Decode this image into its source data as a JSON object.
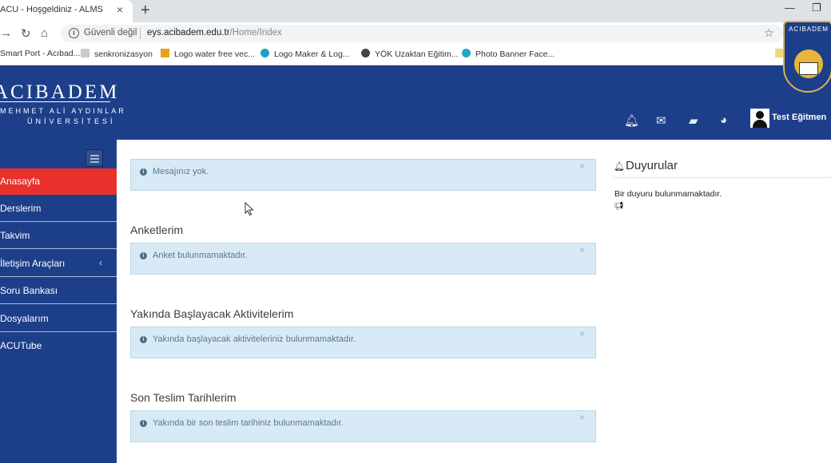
{
  "browser": {
    "tab_title": "ACU - Hoşgeldiniz - ALMS",
    "tab_close": "×",
    "new_tab": "+",
    "security_label": "Güvenli değil",
    "url_host": "eys.acibadem.edu.tr",
    "url_path": "/Home/Index",
    "bookmarks": [
      "Smart Port - Acıbad...",
      "senkronizasyon",
      "Logo water free vec...",
      "Logo Maker & Log...",
      "YÖK Uzaktan Eğitim...",
      "Photo Banner Face..."
    ]
  },
  "header": {
    "logo_main": "ACIBADEM",
    "logo_sub1": "MEHMET ALİ AYDINLAR",
    "logo_sub2": "ÜNİVERSİTESİ",
    "user_name": "Test Eğitmen",
    "emblem_text": "ACIBADEM"
  },
  "sidebar": {
    "items": [
      {
        "label": "Anasayfa",
        "active": true
      },
      {
        "label": "Derslerim"
      },
      {
        "label": "Takvim"
      },
      {
        "label": "İletişim Araçları",
        "has_submenu": true
      },
      {
        "label": "Soru Bankası"
      },
      {
        "label": "Dosyalarım"
      },
      {
        "label": "ACUTube"
      }
    ]
  },
  "main": {
    "messages_alert": "Mesajınız yok.",
    "surveys_title": "Anketlerim",
    "surveys_alert": "Anket bulunmamaktadır.",
    "upcoming_title": "Yakında Başlayacak Aktivitelerim",
    "upcoming_alert": "Yakında başlayacak aktiviteleriniz bulunmamaktadır.",
    "deadlines_title": "Son Teslim Tarihlerim",
    "deadlines_alert": "Yakında bir son teslim tarihiniz bulunmamaktadır."
  },
  "announcements": {
    "title": "Duyurular",
    "empty_text": "Bir duyuru bulunmamaktadır."
  }
}
